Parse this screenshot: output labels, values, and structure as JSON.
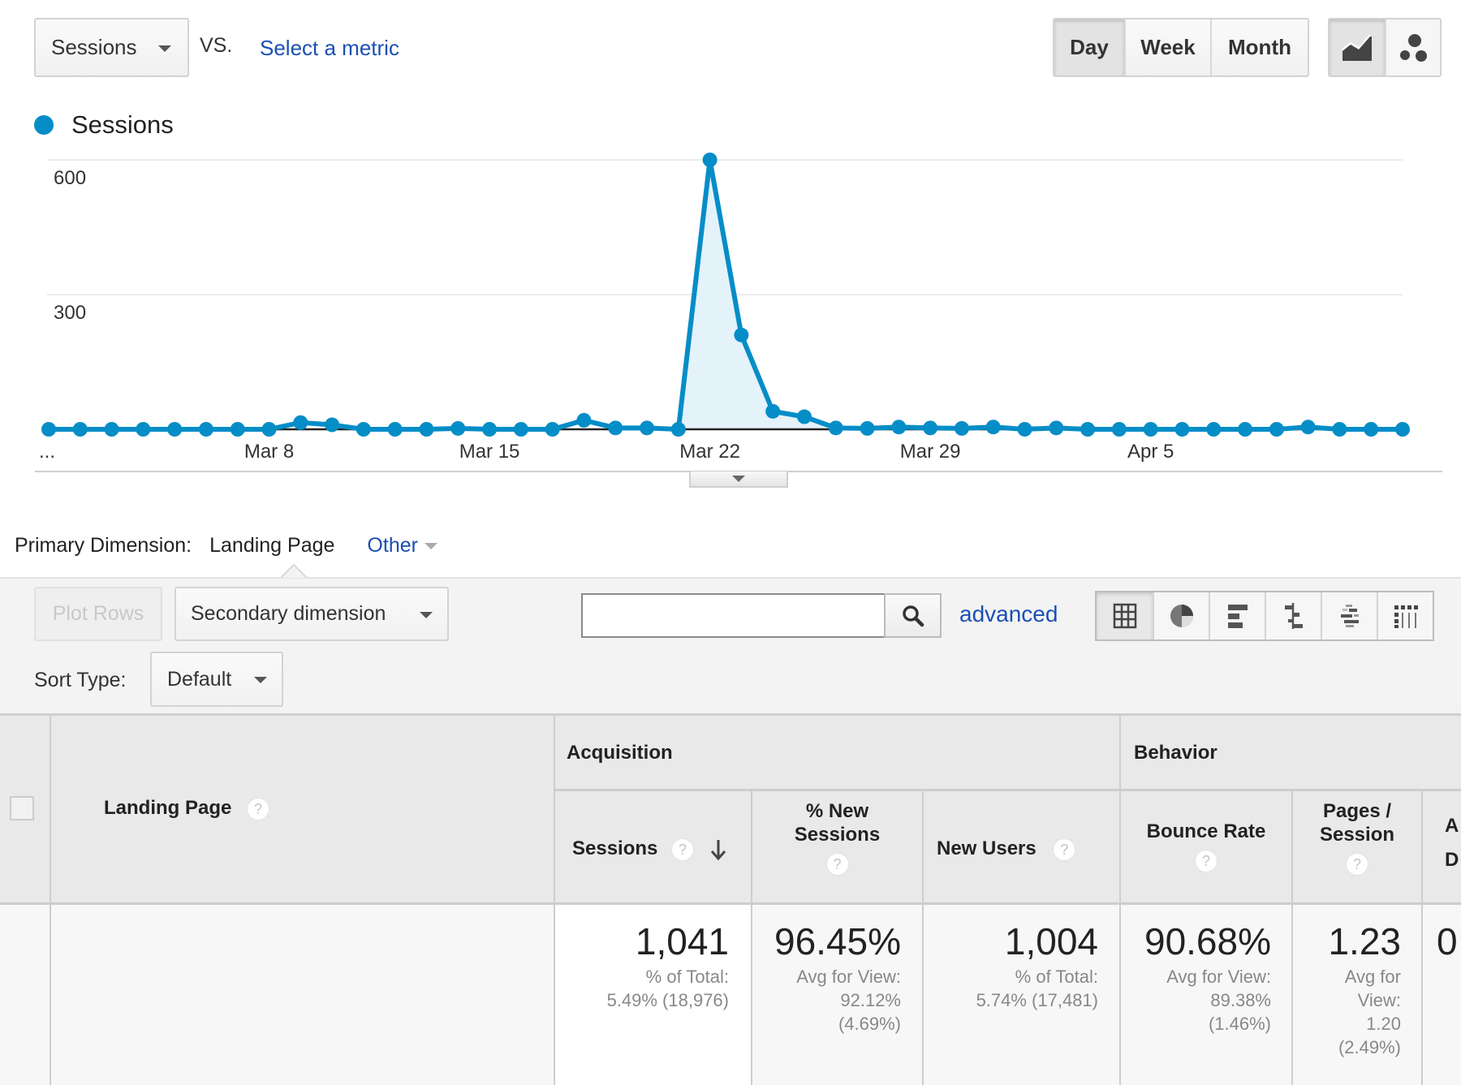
{
  "top_bar": {
    "metric_selector": "Sessions",
    "vs_label": "VS.",
    "select_metric_link": "Select a metric",
    "period_buttons": [
      {
        "label": "Day",
        "active": true
      },
      {
        "label": "Week",
        "active": false
      },
      {
        "label": "Month",
        "active": false
      }
    ],
    "chart_type_buttons": [
      {
        "name": "line-chart-icon",
        "active": true
      },
      {
        "name": "motion-chart-icon",
        "active": false
      }
    ]
  },
  "chart_data": {
    "type": "area",
    "title": "",
    "legend": [
      {
        "name": "Sessions",
        "color": "#058dc7"
      }
    ],
    "legend_placement": "top-left",
    "xlabel": "",
    "ylabel": "",
    "ylim": [
      0,
      650
    ],
    "yticks": [
      300,
      600
    ],
    "grid": true,
    "x": [
      "Mar 1",
      "Mar 2",
      "Mar 3",
      "Mar 4",
      "Mar 5",
      "Mar 6",
      "Mar 7",
      "Mar 8",
      "Mar 9",
      "Mar 10",
      "Mar 11",
      "Mar 12",
      "Mar 13",
      "Mar 14",
      "Mar 15",
      "Mar 16",
      "Mar 17",
      "Mar 18",
      "Mar 19",
      "Mar 20",
      "Mar 21",
      "Mar 22",
      "Mar 23",
      "Mar 24",
      "Mar 25",
      "Mar 26",
      "Mar 27",
      "Mar 28",
      "Mar 29",
      "Mar 30",
      "Mar 31",
      "Apr 1",
      "Apr 2",
      "Apr 3",
      "Apr 4",
      "Apr 5",
      "Apr 6",
      "Apr 7",
      "Apr 8",
      "Apr 9",
      "Apr 10",
      "Apr 11",
      "Apr 12",
      "Apr 13"
    ],
    "x_tick_labels": [
      {
        "label": "...",
        "index": 0
      },
      {
        "label": "Mar 8",
        "index": 7
      },
      {
        "label": "Mar 15",
        "index": 14
      },
      {
        "label": "Mar 22",
        "index": 21
      },
      {
        "label": "Mar 29",
        "index": 28
      },
      {
        "label": "Apr 5",
        "index": 35
      }
    ],
    "series": [
      {
        "name": "Sessions",
        "color": "#058dc7",
        "values": [
          0,
          0,
          0,
          0,
          0,
          0,
          0,
          0,
          15,
          10,
          0,
          0,
          0,
          2,
          0,
          0,
          0,
          20,
          3,
          3,
          0,
          600,
          210,
          40,
          28,
          3,
          2,
          5,
          3,
          2,
          5,
          0,
          3,
          0,
          0,
          0,
          0,
          0,
          0,
          0,
          5,
          0,
          0,
          0
        ]
      }
    ],
    "highlight_range": {
      "from": "Mar 21",
      "to": "Mar 26"
    }
  },
  "primary_dimension": {
    "label": "Primary Dimension:",
    "value": "Landing Page",
    "other": "Other"
  },
  "toolbar": {
    "plot_rows": "Plot Rows",
    "secondary_dimension": "Secondary dimension",
    "sort_type_label": "Sort Type:",
    "sort_type_value": "Default",
    "search_value": "",
    "advanced_link": "advanced",
    "view_buttons": [
      {
        "name": "data-table-icon",
        "active": true
      },
      {
        "name": "percentage-pie-icon",
        "active": false
      },
      {
        "name": "performance-bar-icon",
        "active": false
      },
      {
        "name": "comparison-icon",
        "active": false
      },
      {
        "name": "term-cloud-icon",
        "active": false
      },
      {
        "name": "pivot-icon",
        "active": false
      }
    ]
  },
  "table": {
    "groups": {
      "acquisition": "Acquisition",
      "behavior": "Behavior"
    },
    "columns": {
      "landing_page": "Landing Page",
      "sessions": "Sessions",
      "pct_new_sessions_1": "% New",
      "pct_new_sessions_2": "Sessions",
      "new_users": "New Users",
      "bounce_rate": "Bounce Rate",
      "pages_session_1": "Pages /",
      "pages_session_2": "Session",
      "avg_duration_1": "A",
      "avg_duration_2": "D"
    },
    "help_glyph": "?",
    "totals": {
      "sessions": {
        "value": "1,041",
        "line1": "% of Total:",
        "line2": "5.49% (18,976)"
      },
      "pct_new_sessions": {
        "value": "96.45%",
        "line1": "Avg for View:",
        "line2": "92.12%",
        "line3": "(4.69%)"
      },
      "new_users": {
        "value": "1,004",
        "line1": "% of Total:",
        "line2": "5.74% (17,481)"
      },
      "bounce_rate": {
        "value": "90.68%",
        "line1": "Avg for View:",
        "line2": "89.38%",
        "line3": "(1.46%)"
      },
      "pages_session": {
        "value": "1.23",
        "line1": "Avg for",
        "line2": "View:",
        "line3": "1.20",
        "line4": "(2.49%)"
      },
      "avg_duration": {
        "value": "0"
      }
    }
  }
}
